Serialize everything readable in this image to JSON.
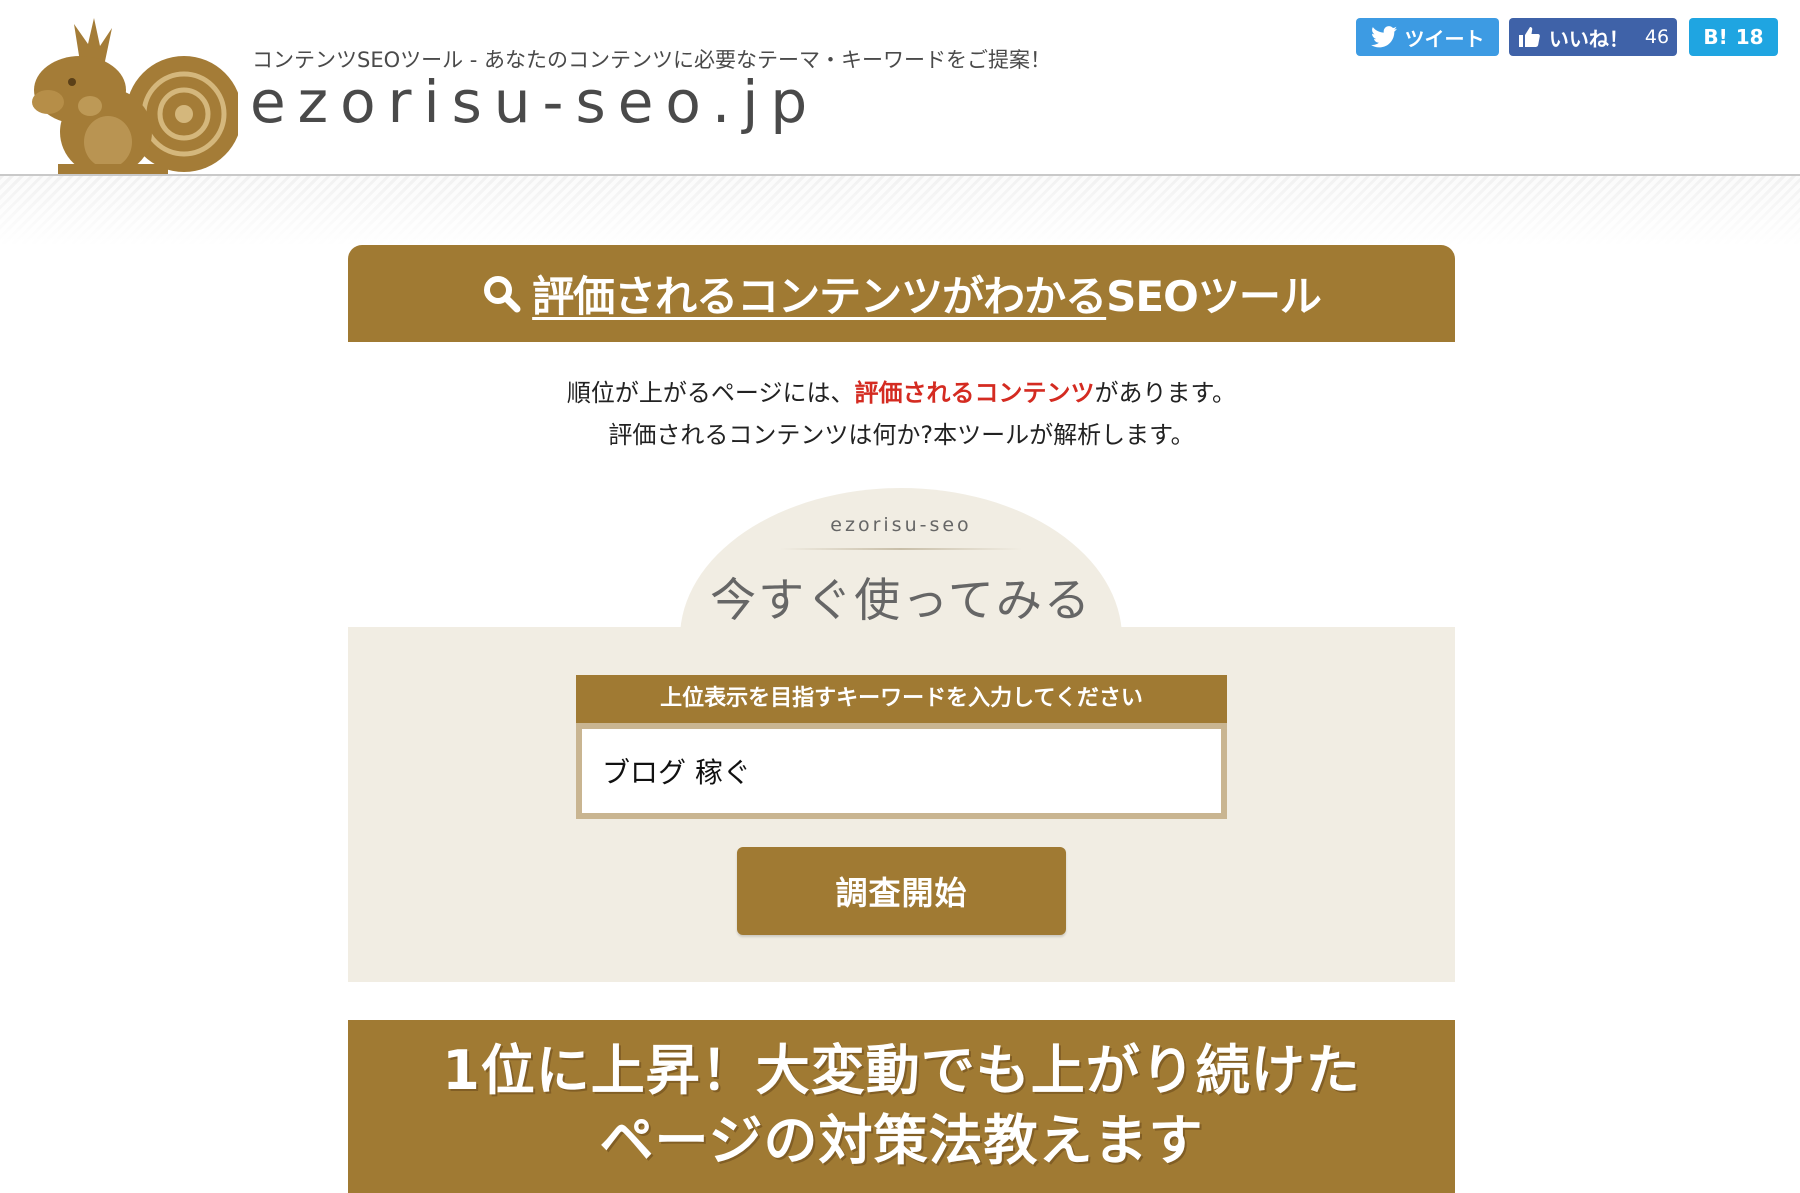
{
  "header": {
    "tagline": "コンテンツSEOツール - あなたのコンテンツに必要なテーマ・キーワードをご提案！",
    "site_title": "ezorisu-seo.jp",
    "mascot_icon": "squirrel-logo"
  },
  "share": {
    "tweet_label": "ツイート",
    "like_label": "いいね！",
    "like_count": "46",
    "hatena_label": "B!",
    "hatena_count": "18"
  },
  "hero": {
    "icon": "search-icon",
    "title_underlined": "評価されるコンテンツがわかる",
    "title_rest": "SEOツール"
  },
  "intro": {
    "line1_before": "順位が上がるページには、",
    "line1_highlight": "評価されるコンテンツ",
    "line1_after": "があります。",
    "line2": "評価されるコンテンツは何か?本ツールが解析します。"
  },
  "search": {
    "dome_label": "ezorisu-seo",
    "dome_title": "今すぐ使ってみる",
    "field_label": "上位表示を目指すキーワードを入力してください",
    "field_value": "ブログ 稼ぐ",
    "submit_label": "調査開始"
  },
  "banner": {
    "line1": "1位に上昇！大変動でも上がり続けた",
    "line2": "ページの対策法教えます"
  },
  "colors": {
    "brand_gold": "#a07a33",
    "panel_beige": "#f1ede3",
    "highlight_red": "#d42b21",
    "twitter_blue": "#3d9be3",
    "facebook_blue": "#3f62a8",
    "hatena_blue": "#1fa5e1"
  }
}
